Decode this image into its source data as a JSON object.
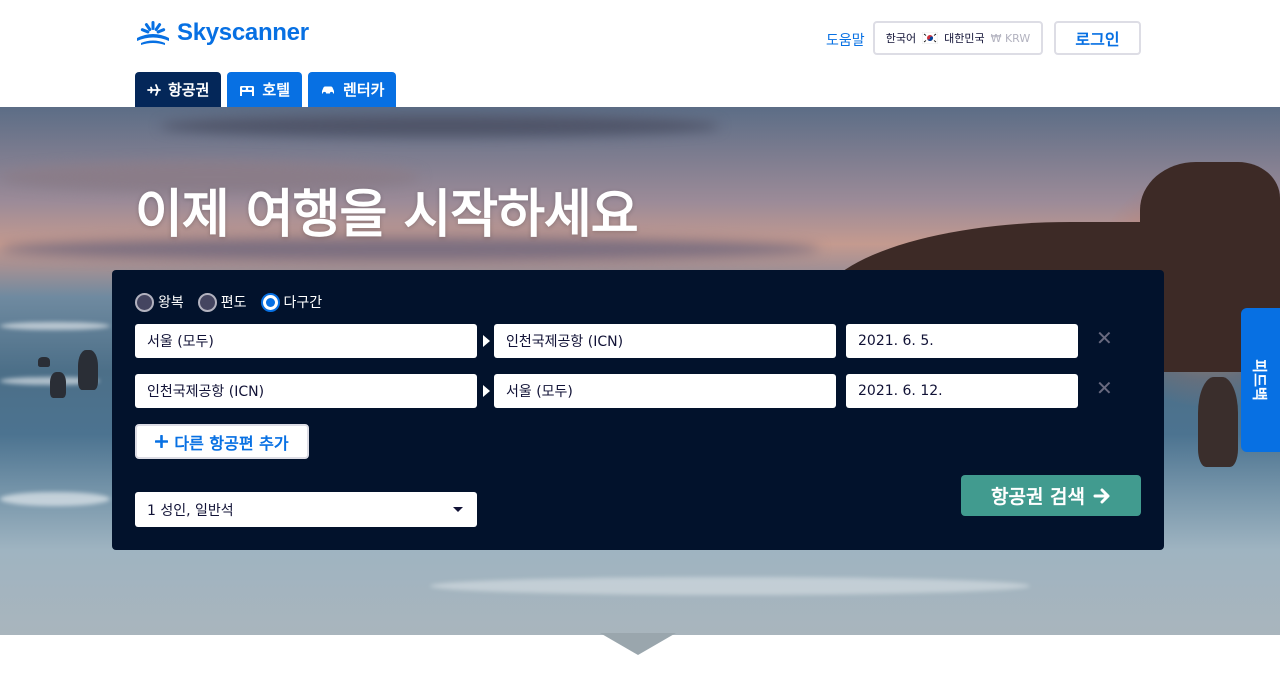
{
  "header": {
    "logo_text": "Skyscanner",
    "help_label": "도움말",
    "locale": {
      "language": "한국어",
      "country": "대한민국",
      "currency": "₩ KRW"
    },
    "login_label": "로그인"
  },
  "tabs": [
    {
      "label": "항공권",
      "icon": "airplane-icon",
      "active": true
    },
    {
      "label": "호텔",
      "icon": "bed-icon",
      "active": false
    },
    {
      "label": "렌터카",
      "icon": "car-icon",
      "active": false
    }
  ],
  "hero": {
    "headline": "이제 여행을 시작하세요"
  },
  "search": {
    "trip_types": [
      {
        "label": "왕복",
        "selected": false
      },
      {
        "label": "편도",
        "selected": false
      },
      {
        "label": "다구간",
        "selected": true
      }
    ],
    "legs": [
      {
        "from": "서울 (모두)",
        "to": "인천국제공항 (ICN)",
        "date": "2021. 6. 5."
      },
      {
        "from": "인천국제공항 (ICN)",
        "to": "서울 (모두)",
        "date": "2021. 6. 12."
      }
    ],
    "add_leg_label": "다른 항공편 추가",
    "travellers": "1 성인, 일반석",
    "search_label": "항공권 검색"
  },
  "feedback_label": "피드백",
  "colors": {
    "brand": "#0770e3",
    "panel": "#02122c",
    "search_button": "#419b8f",
    "active_tab": "#042759"
  }
}
